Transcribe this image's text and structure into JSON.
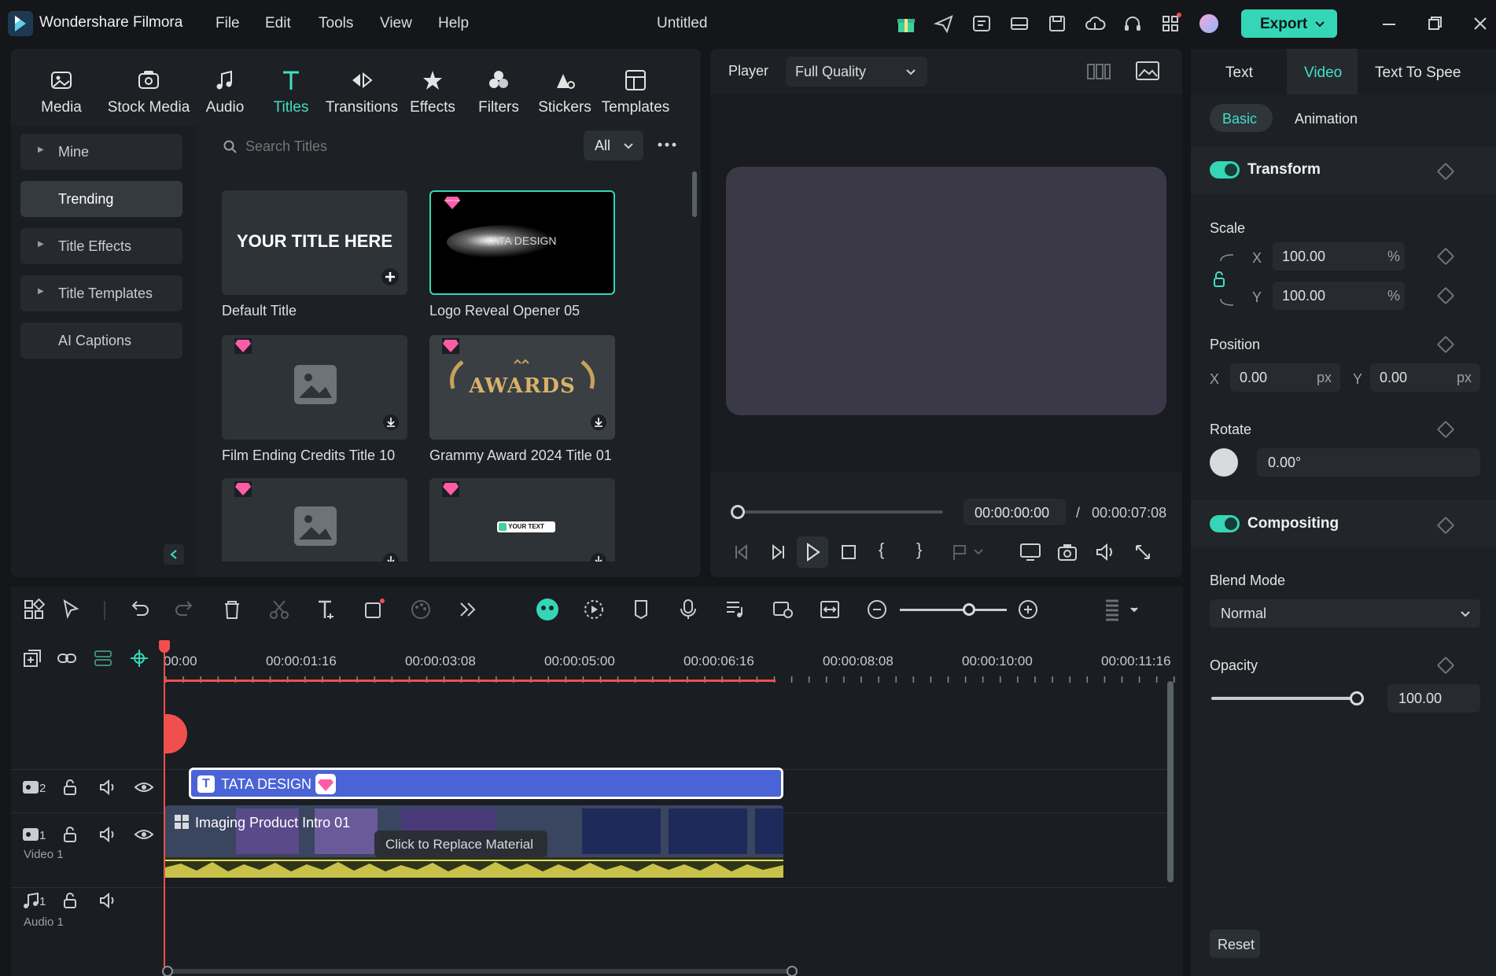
{
  "app": {
    "name": "Wondershare Filmora",
    "document_title": "Untitled"
  },
  "menu": [
    "File",
    "Edit",
    "Tools",
    "View",
    "Help"
  ],
  "toolbar": {
    "export_label": "Export"
  },
  "library": {
    "tabs": [
      {
        "label": "Media",
        "icon": "media-icon"
      },
      {
        "label": "Stock Media",
        "icon": "stock-media-icon"
      },
      {
        "label": "Audio",
        "icon": "audio-icon"
      },
      {
        "label": "Titles",
        "icon": "titles-icon",
        "active": true
      },
      {
        "label": "Transitions",
        "icon": "transitions-icon"
      },
      {
        "label": "Effects",
        "icon": "effects-icon"
      },
      {
        "label": "Filters",
        "icon": "filters-icon"
      },
      {
        "label": "Stickers",
        "icon": "stickers-icon"
      },
      {
        "label": "Templates",
        "icon": "templates-icon"
      }
    ],
    "sidebar": [
      {
        "label": "Mine",
        "caret": true
      },
      {
        "label": "Trending",
        "caret": false,
        "active": true
      },
      {
        "label": "Title Effects",
        "caret": true
      },
      {
        "label": "Title Templates",
        "caret": true
      },
      {
        "label": "AI Captions",
        "caret": false
      }
    ],
    "search": {
      "placeholder": "Search Titles",
      "filter": "All"
    },
    "items": [
      {
        "label": "Default Title",
        "thumb_text": "YOUR TITLE HERE"
      },
      {
        "label": "Logo Reveal Opener 05",
        "thumb_text": "TATA DESIGN"
      },
      {
        "label": "Film Ending Credits Title 10"
      },
      {
        "label": "Grammy Award 2024 Title 01",
        "thumb_text": "AWARDS"
      },
      {
        "label": ""
      },
      {
        "label": "",
        "thumb_text": "YOUR TEXT"
      }
    ]
  },
  "player": {
    "label": "Player",
    "quality": "Full Quality",
    "current_time": "00:00:00:00",
    "separator": "/",
    "total_time": "00:00:07:08"
  },
  "properties": {
    "tabs": [
      "Text",
      "Video",
      "Text To Spee"
    ],
    "active_tab": "Video",
    "subtabs": [
      "Basic",
      "Animation"
    ],
    "transform_label": "Transform",
    "scale_label": "Scale",
    "scale_x": "100.00",
    "scale_y": "100.00",
    "axis_x": "X",
    "axis_y": "Y",
    "percent": "%",
    "position_label": "Position",
    "position_x": "0.00",
    "position_y": "0.00",
    "px": "px",
    "rotate_label": "Rotate",
    "rotate_value": "0.00°",
    "compositing_label": "Compositing",
    "blend_label": "Blend Mode",
    "blend_value": "Normal",
    "opacity_label": "Opacity",
    "opacity_value": "100.00",
    "reset_label": "Reset"
  },
  "timeline": {
    "ruler": [
      "00:00",
      "00:00:01:16",
      "00:00:03:08",
      "00:00:05:00",
      "00:00:06:16",
      "00:00:08:08",
      "00:00:10:00",
      "00:00:11:16"
    ],
    "title_clip": "TATA DESIGN",
    "video_clip": "Imaging Product Intro 01",
    "tooltip": "Click to Replace Material",
    "track_video2_num": "2",
    "track_video1_num": "1",
    "track_video1_label": "Video 1",
    "track_audio1_num": "1",
    "track_audio1_label": "Audio 1"
  },
  "colors": {
    "accent": "#35d6b7",
    "title_clip": "#4a63d6",
    "playhead": "#f0504d",
    "audio_wave": "#c8c24a"
  }
}
